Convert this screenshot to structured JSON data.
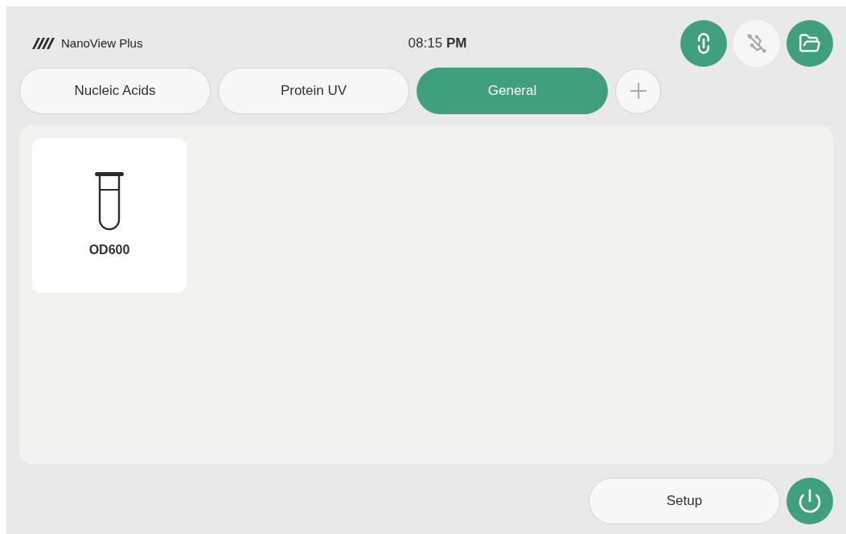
{
  "header": {
    "brand": "NanoView Plus",
    "time": "08:15 **PM**",
    "status_buttons": [
      {
        "kind": "link",
        "on": true
      },
      {
        "kind": "usb",
        "on": false
      },
      {
        "kind": "folder",
        "on": true
      }
    ]
  },
  "tabs": [
    {
      "label": "Nucleic Acids",
      "selected": false
    },
    {
      "label": "Protein UV",
      "selected": false
    },
    {
      "label": "General",
      "selected": true
    }
  ],
  "apps": [
    {
      "kind": "tube",
      "label": "OD600"
    }
  ],
  "footer": {
    "setup": "Setup"
  }
}
